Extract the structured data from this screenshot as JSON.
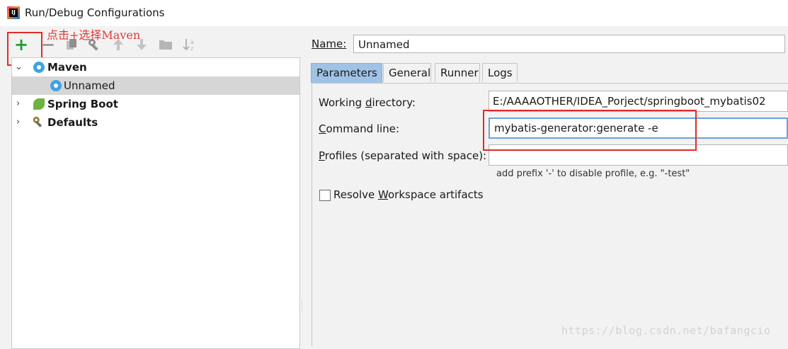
{
  "window": {
    "title": "Run/Debug Configurations"
  },
  "annotation": {
    "text": "点击+选择Maven"
  },
  "toolbar": {
    "add_icon": "plus-icon",
    "remove_icon": "minus-icon",
    "copy_icon": "copy-icon",
    "edit_defaults_icon": "wrench-icon",
    "move_up_icon": "arrow-up-icon",
    "move_down_icon": "arrow-down-icon",
    "folder_icon": "folder-icon",
    "sort_icon": "sort-az-icon"
  },
  "tree": {
    "items": [
      {
        "label": "Maven",
        "expanded": true,
        "icon": "maven-gear-icon"
      },
      {
        "label": "Unnamed",
        "selected": true,
        "icon": "maven-gear-icon"
      },
      {
        "label": "Spring Boot",
        "expanded": false,
        "icon": "spring-leaf-icon"
      },
      {
        "label": "Defaults",
        "expanded": false,
        "icon": "wrench-icon"
      }
    ]
  },
  "config": {
    "name_label": "Name:",
    "name_value": "Unnamed",
    "tabs": [
      {
        "label": "Parameters",
        "active": true
      },
      {
        "label": "General"
      },
      {
        "label": "Runner"
      },
      {
        "label": "Logs"
      }
    ],
    "working_dir_label_pre": "Working ",
    "working_dir_label_u": "d",
    "working_dir_label_post": "irectory:",
    "working_dir_value": "E:/AAAAOTHER/IDEA_Porject/springboot_mybatis02",
    "command_line_label_u": "C",
    "command_line_label_post": "ommand line:",
    "command_line_value": "mybatis-generator:generate -e",
    "profiles_label_u": "P",
    "profiles_label_post": "rofiles (separated with space):",
    "profiles_value": "",
    "profiles_hint": "add prefix '-' to disable profile, e.g. \"-test\"",
    "resolve_label_pre": "Resolve ",
    "resolve_label_u": "W",
    "resolve_label_post": "orkspace artifacts",
    "resolve_checked": false
  },
  "watermark": {
    "text": "https://blog.csdn.net/bafangcio"
  },
  "colors": {
    "accent_tab": "#9fc3e6",
    "highlight_box": "#e02b2b",
    "add_green": "#1f9d2e"
  }
}
